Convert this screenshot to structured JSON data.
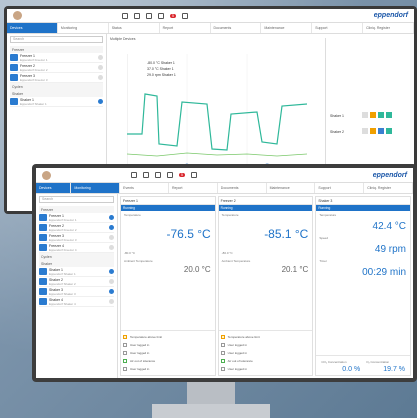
{
  "back_screen": {
    "logo": "eppendorf",
    "badge_count": "5",
    "tabs": [
      "Devices",
      "Monitoring",
      "Status",
      "Report",
      "Documents",
      "Maintenance",
      "Support",
      "Cliniq. Register"
    ],
    "search_placeholder": "Search",
    "groups": [
      "Freezer",
      "Cyclen",
      "Shaker"
    ],
    "devices": [
      {
        "name": "Freezer 1",
        "sub": "Eppendorf Freezer 1"
      },
      {
        "name": "Freezer 2",
        "sub": "Eppendorf Freezer 2"
      },
      {
        "name": "Freezer 3",
        "sub": "Eppendorf Freezer 3"
      },
      {
        "name": "Shaker 1",
        "sub": "Eppendorf Shaker 1"
      }
    ],
    "chart_title": "Multiple Devices",
    "legend": [
      "-80.0 °C  Shaker 1",
      "37.0 °C  Shaker 1",
      "29.0 rpm  Shaker 1"
    ],
    "right_labels": [
      "Shaker 1",
      "Shaker 2"
    ]
  },
  "front_screen": {
    "logo": "eppendorf",
    "badge_count": "5",
    "tabs": [
      "Devices",
      "Monitoring",
      "Events",
      "Report",
      "Documents",
      "Maintenance",
      "Support",
      "Cliniq. Register"
    ],
    "search_placeholder": "Search",
    "groups": [
      "Freezer",
      "Cyclen",
      "Shaker"
    ],
    "devices": [
      {
        "name": "Freezer 1",
        "sub": "Eppendorf Freezer 1"
      },
      {
        "name": "Freezer 2",
        "sub": "Eppendorf Freezer 2"
      },
      {
        "name": "Freezer 3",
        "sub": "Eppendorf Freezer 3"
      },
      {
        "name": "Freezer 4",
        "sub": "Eppendorf Freezer 4"
      },
      {
        "name": "Shaker 1",
        "sub": "Eppendorf Shaker 1"
      },
      {
        "name": "Shaker 2",
        "sub": "Eppendorf Shaker 2"
      },
      {
        "name": "Shaker 3",
        "sub": "Eppendorf Shaker 3"
      },
      {
        "name": "Shaker 4",
        "sub": "Eppendorf Shaker 4"
      }
    ],
    "panels": [
      {
        "title": "Freezer 1",
        "status": "Running",
        "temp_label": "Temperature",
        "temp": "-76.5 °C",
        "setpoint_label": "-80.0 °C",
        "ambient_label": "Ambient Temperature",
        "ambient": "20.0 °C",
        "log": [
          "Temperature above limit",
          "User logged in",
          "User logged in",
          "Air out of tolerance",
          "User logged in"
        ]
      },
      {
        "title": "Freezer 2",
        "status": "Running",
        "temp_label": "Temperature",
        "temp": "-85.1 °C",
        "setpoint_label": "-80.0 °C",
        "ambient_label": "Ambient Temperature",
        "ambient": "20.1 °C",
        "log": [
          "Temperature above limit",
          "User logged in",
          "User logged in",
          "Air out of tolerance",
          "User logged in"
        ]
      },
      {
        "title": "Shaker 3",
        "status": "Running",
        "temp_label": "Temperature",
        "temp": "42.4 °C",
        "speed_label": "Speed",
        "speed": "49 rpm",
        "timer_label": "Timer",
        "timer": "00:29 min",
        "co2_label": "CO₂ Concentration",
        "co2": "0.0 %",
        "o2_label": "O₂ Concentration",
        "o2": "19.7 %"
      }
    ]
  }
}
